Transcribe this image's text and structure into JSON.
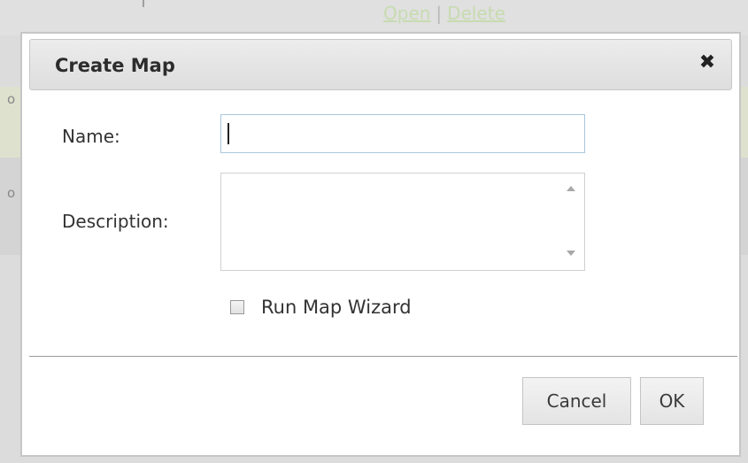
{
  "background": {
    "links": {
      "open": "Open",
      "separator": "|",
      "delete": "Delete"
    },
    "row_markers": [
      "o",
      "o"
    ]
  },
  "dialog": {
    "title": "Create Map",
    "close_icon": "close-icon",
    "fields": {
      "name_label": "Name:",
      "name_value": "",
      "description_label": "Description:",
      "description_value": ""
    },
    "checkbox": {
      "label": "Run Map Wizard",
      "checked": false
    },
    "buttons": {
      "cancel": "Cancel",
      "ok": "OK"
    }
  }
}
